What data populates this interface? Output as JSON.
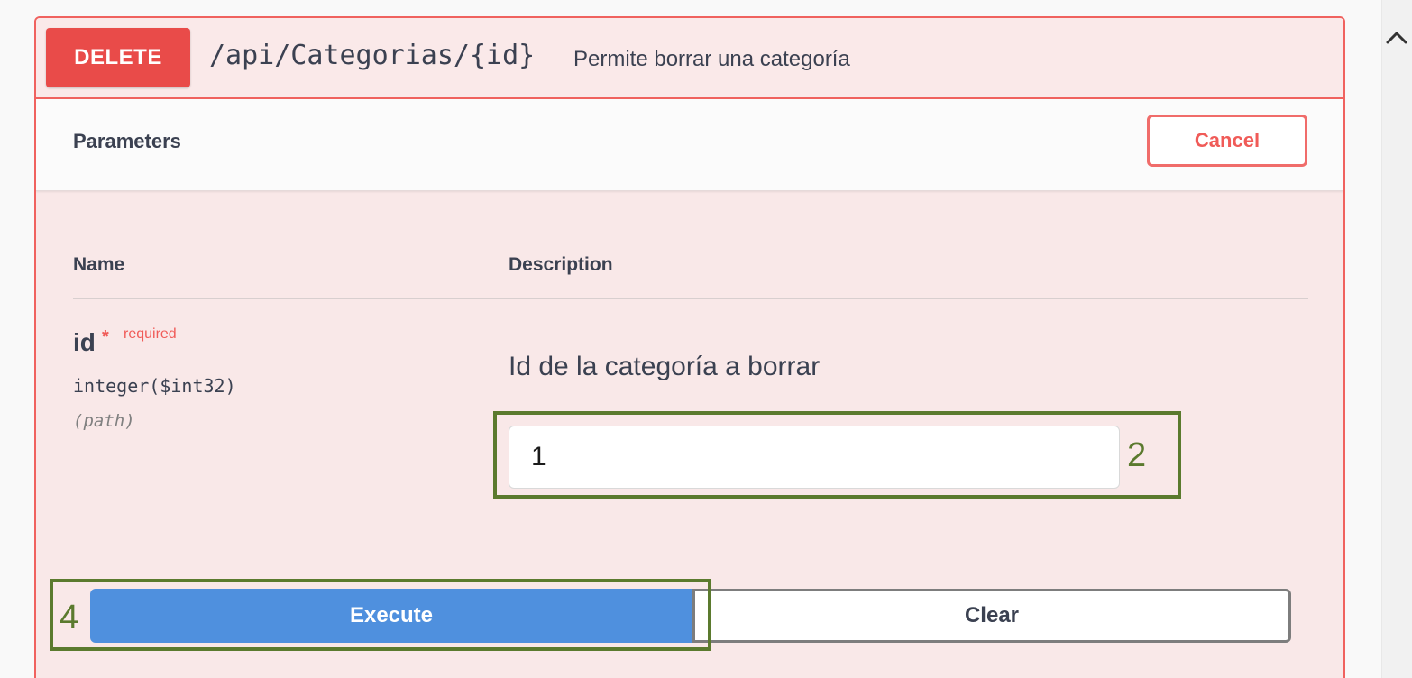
{
  "operation": {
    "method": "DELETE",
    "path": "/api/Categorias/{id}",
    "summary": "Permite borrar una categoría"
  },
  "parameters_section": {
    "title": "Parameters",
    "cancel_label": "Cancel",
    "column_name": "Name",
    "column_description": "Description"
  },
  "parameter": {
    "name": "id",
    "required_star": "*",
    "required_label": "required",
    "type": "integer($int32)",
    "location": "(path)",
    "description": "Id de la categoría a borrar",
    "value": "1"
  },
  "actions": {
    "execute_label": "Execute",
    "clear_label": "Clear"
  },
  "annotations": {
    "input_marker": "2",
    "execute_marker": "4"
  },
  "icons": {
    "scroll_up": "chevron-up-icon"
  },
  "colors": {
    "delete_method": "#e94b49",
    "opblock_border": "#f0625f",
    "opblock_background": "#f9e8e8",
    "execute": "#4f90de",
    "annotation": "#5b7a2e"
  }
}
